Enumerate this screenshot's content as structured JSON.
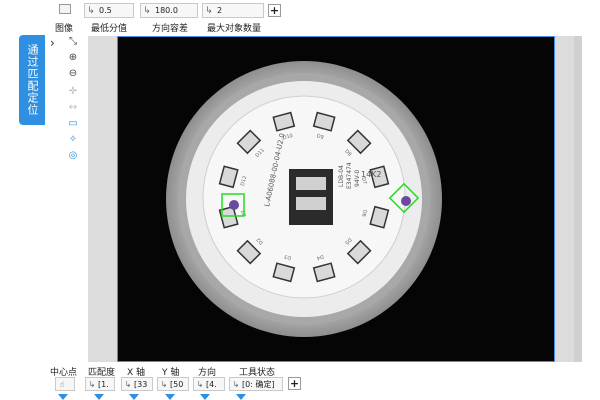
{
  "side_tab": {
    "label": "通过匹配定位"
  },
  "top_params": [
    {
      "label": "图像",
      "value": ""
    },
    {
      "label": "最低分值",
      "value": "0.5"
    },
    {
      "label": "方向容差",
      "value": "180.0"
    },
    {
      "label": "最大对象数量",
      "value": "2"
    }
  ],
  "add_label": "+",
  "bottom_labels": [
    "中心点",
    "匹配度",
    "X 轴",
    "Y 轴",
    "方向",
    "工具状态"
  ],
  "bottom_cells": [
    "[1.",
    "[33",
    "[50",
    "[4.",
    "[0: 确定]"
  ],
  "pcb": {
    "left_labels": [
      "L-A06088-00-04-U2.0"
    ],
    "right_labels": [
      "LDB-04",
      "E347474",
      "94V-0"
    ],
    "marks": [
      "14K2",
      "1",
      "2"
    ],
    "led_labels": [
      "D10",
      "D9",
      "D8",
      "D7",
      "D6",
      "D5",
      "D4",
      "D3",
      "D2",
      "D1",
      "D12",
      "D11"
    ]
  },
  "colors": {
    "accent": "#2f8fe0",
    "match": "#22dd22",
    "frame_border": "#4a90e2"
  }
}
